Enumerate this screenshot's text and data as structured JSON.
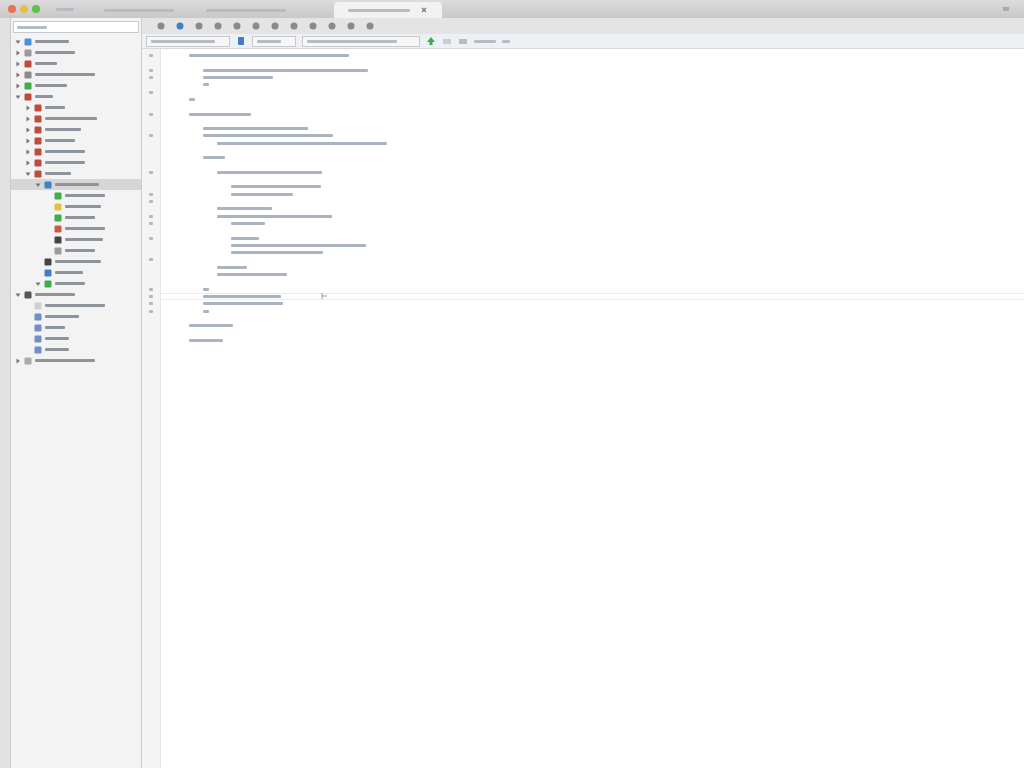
{
  "window": {
    "tabs": [
      {
        "selected": false
      },
      {
        "selected": false
      },
      {
        "selected": true
      }
    ]
  },
  "sidebar": {
    "tree": [
      {
        "color": "#4a8fd8",
        "expanded": true,
        "selected": false
      },
      {
        "color": "#9a9a9a",
        "expanded": false,
        "selected": false
      },
      {
        "color": "#c04a3c",
        "expanded": false,
        "selected": false
      },
      {
        "color": "#8a8a8a",
        "expanded": false,
        "selected": false
      },
      {
        "color": "#3fae49",
        "expanded": false,
        "selected": false
      },
      {
        "color": "#c04a3c",
        "expanded": true,
        "selected": false,
        "children": [
          {
            "color": "#c04a3c",
            "expanded": false,
            "selected": false
          },
          {
            "color": "#c04a3c",
            "expanded": false,
            "selected": false
          },
          {
            "color": "#c04a3c",
            "expanded": false,
            "selected": false
          },
          {
            "color": "#c04a3c",
            "expanded": false,
            "selected": false
          },
          {
            "color": "#c04a3c",
            "expanded": false,
            "selected": false
          },
          {
            "color": "#c04a3c",
            "expanded": false,
            "selected": false
          },
          {
            "color": "#c04a3c",
            "expanded": true,
            "selected": false,
            "children": [
              {
                "color": "#3f7fc6",
                "expanded": true,
                "selected": true,
                "children": [
                  {
                    "color": "#3fae49",
                    "selected": false
                  },
                  {
                    "color": "#e0c23a",
                    "selected": false
                  },
                  {
                    "color": "#3fae49",
                    "selected": false
                  },
                  {
                    "color": "#d0564a",
                    "selected": false
                  },
                  {
                    "color": "#444444",
                    "selected": false
                  },
                  {
                    "color": "#9a9a9a",
                    "selected": false
                  }
                ]
              },
              {
                "color": "#444444",
                "selected": false
              },
              {
                "color": "#3f7fc6",
                "selected": false
              },
              {
                "color": "#3fae49",
                "expanded": true,
                "selected": false
              }
            ]
          }
        ]
      },
      {
        "color": "#555555",
        "expanded": true,
        "selected": false,
        "children": [
          {
            "color": "#cfcfcf",
            "selected": false
          },
          {
            "color": "#6f8fc6",
            "selected": false
          },
          {
            "color": "#6f8fc6",
            "selected": false
          },
          {
            "color": "#6f8fc6",
            "selected": false
          },
          {
            "color": "#6f8fc6",
            "selected": false
          }
        ]
      },
      {
        "color": "#aaaaaa",
        "expanded": false,
        "selected": false
      }
    ]
  },
  "editor": {
    "code": [
      {
        "kind": "line"
      },
      {
        "kind": "block",
        "children": [
          {
            "kind": "blank"
          },
          {
            "kind": "line"
          },
          {
            "kind": "line"
          },
          {
            "kind": "line"
          },
          {
            "kind": "blank"
          }
        ]
      },
      {
        "kind": "line"
      },
      {
        "kind": "blank"
      },
      {
        "kind": "line"
      },
      {
        "kind": "block",
        "children": [
          {
            "kind": "blank"
          },
          {
            "kind": "line"
          },
          {
            "kind": "line"
          },
          {
            "kind": "block",
            "children": [
              {
                "kind": "line"
              }
            ]
          },
          {
            "kind": "blank"
          },
          {
            "kind": "line"
          },
          {
            "kind": "blank"
          },
          {
            "kind": "block",
            "children": [
              {
                "kind": "line"
              },
              {
                "kind": "blank"
              },
              {
                "kind": "block",
                "children": [
                  {
                    "kind": "line"
                  },
                  {
                    "kind": "line"
                  }
                ]
              },
              {
                "kind": "blank"
              },
              {
                "kind": "line"
              },
              {
                "kind": "line"
              },
              {
                "kind": "block",
                "children": [
                  {
                    "kind": "line"
                  },
                  {
                    "kind": "blank"
                  },
                  {
                    "kind": "line"
                  },
                  {
                    "kind": "line"
                  },
                  {
                    "kind": "line"
                  }
                ]
              },
              {
                "kind": "blank"
              },
              {
                "kind": "line"
              },
              {
                "kind": "line"
              }
            ]
          },
          {
            "kind": "blank"
          },
          {
            "kind": "line"
          },
          {
            "kind": "current"
          },
          {
            "kind": "line"
          },
          {
            "kind": "line"
          }
        ]
      },
      {
        "kind": "blank"
      },
      {
        "kind": "line"
      },
      {
        "kind": "blank"
      },
      {
        "kind": "line"
      }
    ]
  }
}
